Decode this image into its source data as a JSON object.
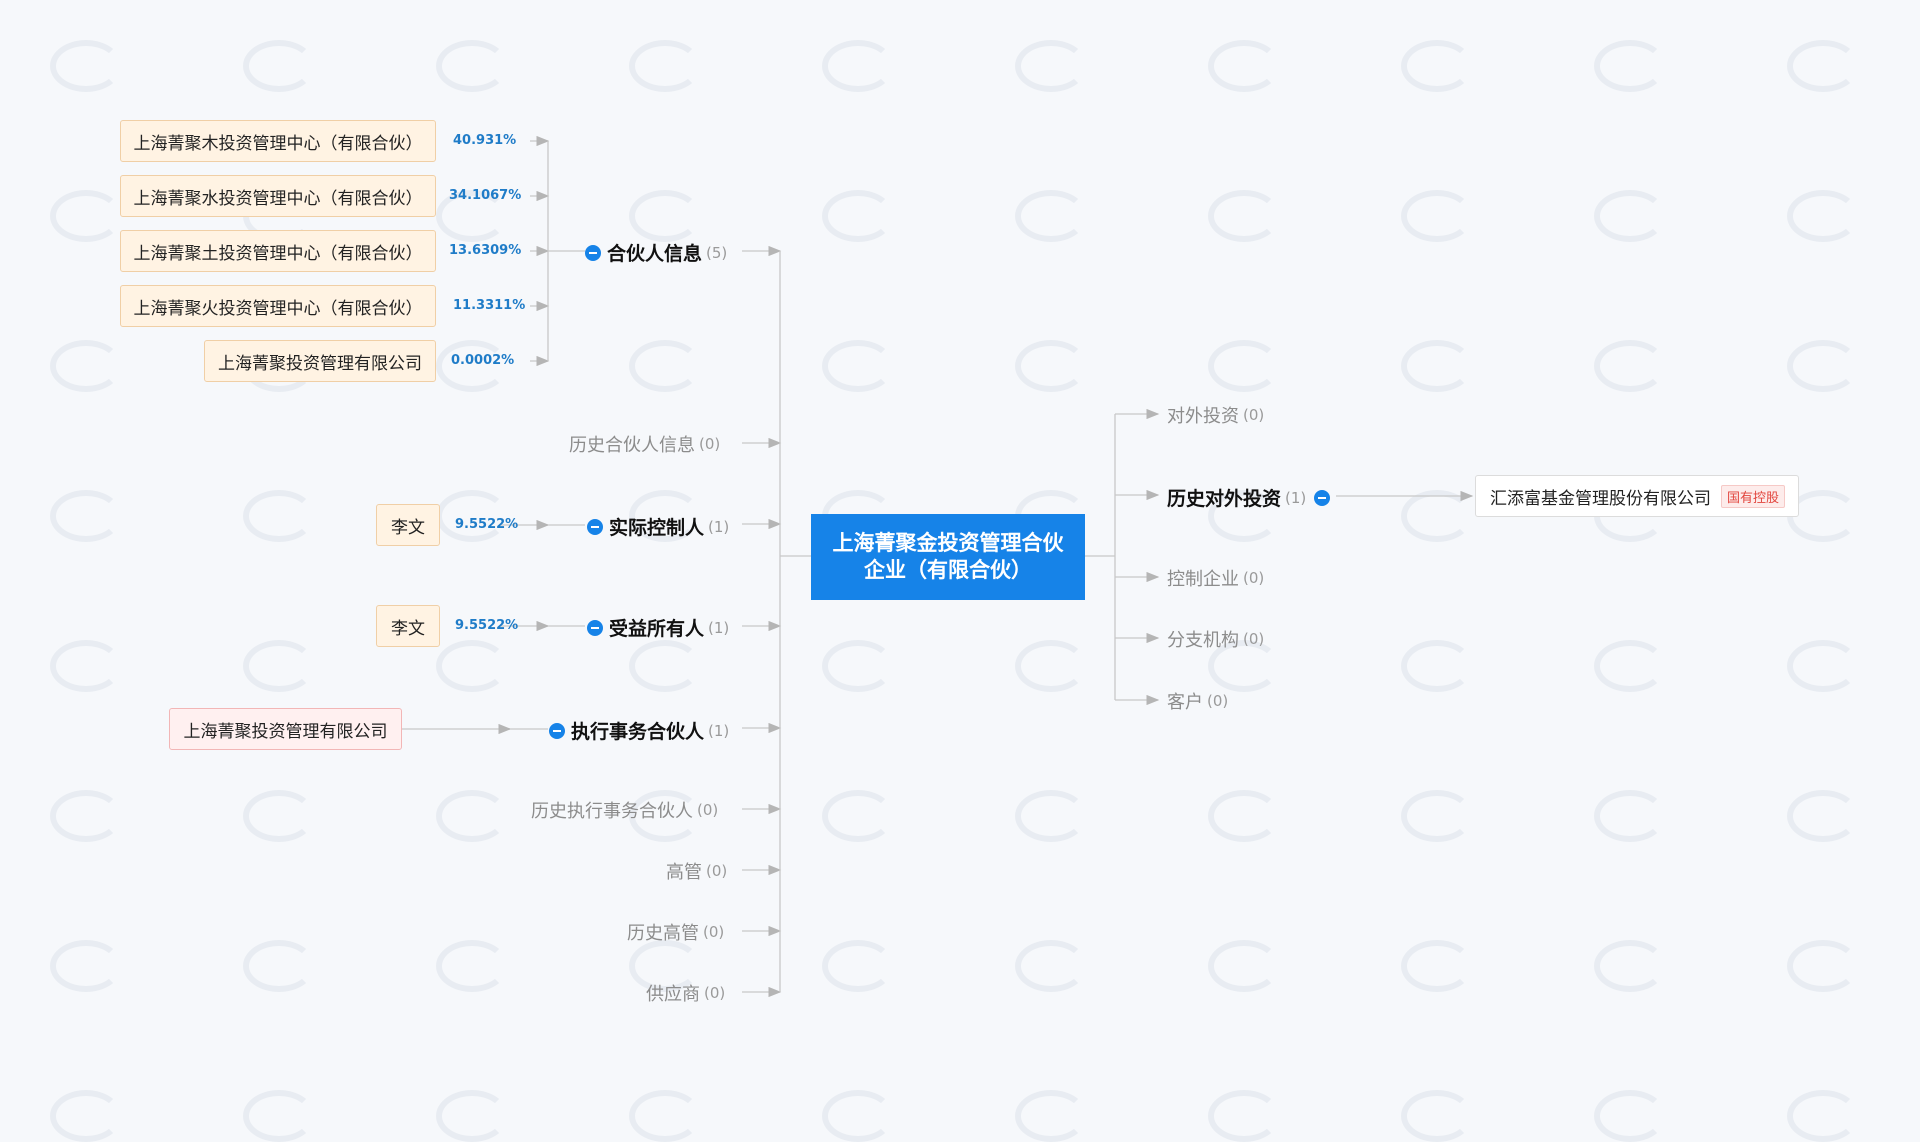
{
  "company": "上海菁聚金投资管理合伙企业（有限合伙）",
  "partners_group": {
    "label": "合伙人信息",
    "count": "(5)",
    "items": [
      {
        "name": "上海菁聚木投资管理中心（有限合伙）",
        "pct": "40.931%"
      },
      {
        "name": "上海菁聚水投资管理中心（有限合伙）",
        "pct": "34.1067%"
      },
      {
        "name": "上海菁聚土投资管理中心（有限合伙）",
        "pct": "13.6309%"
      },
      {
        "name": "上海菁聚火投资管理中心（有限合伙）",
        "pct": "11.3311%"
      },
      {
        "name": "上海菁聚投资管理有限公司",
        "pct": "0.0002%"
      }
    ]
  },
  "history_partners": {
    "label": "历史合伙人信息",
    "count": "(0)"
  },
  "actual_controller": {
    "label": "实际控制人",
    "count": "(1)",
    "person": "李文",
    "pct": "9.5522%"
  },
  "beneficial_owner": {
    "label": "受益所有人",
    "count": "(1)",
    "person": "李文",
    "pct": "9.5522%"
  },
  "executive_partner": {
    "label": "执行事务合伙人",
    "count": "(1)",
    "entity": "上海菁聚投资管理有限公司"
  },
  "history_executive_partner": {
    "label": "历史执行事务合伙人",
    "count": "(0)"
  },
  "executives": {
    "label": "高管",
    "count": "(0)"
  },
  "history_executives": {
    "label": "历史高管",
    "count": "(0)"
  },
  "suppliers": {
    "label": "供应商",
    "count": "(0)"
  },
  "outbound_investment": {
    "label": "对外投资",
    "count": "(0)"
  },
  "history_outbound_investment": {
    "label": "历史对外投资",
    "count": "(1)",
    "entity": "汇添富基金管理股份有限公司",
    "tag": "国有控股"
  },
  "controlled_companies": {
    "label": "控制企业",
    "count": "(0)"
  },
  "branches": {
    "label": "分支机构",
    "count": "(0)"
  },
  "customers": {
    "label": "客户",
    "count": "(0)"
  },
  "colors": {
    "accent": "#1683e8",
    "line": "#c8c8c8",
    "pct": "#1f7cc8",
    "tag": "#e2463e"
  }
}
